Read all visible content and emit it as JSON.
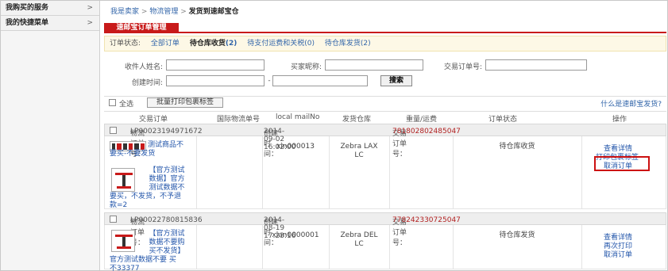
{
  "sidebar": {
    "items": [
      {
        "label": "我购买的服务",
        "arrow": ">"
      },
      {
        "label": "我的快捷菜单",
        "arrow": ">"
      }
    ]
  },
  "breadcrumb": {
    "items": [
      "我是卖家",
      "物流管理"
    ],
    "separator": ">",
    "current": "发货到速邮宝仓"
  },
  "tab": {
    "label": "速邮宝订单管理"
  },
  "status": {
    "label": "订单状态:",
    "filters": [
      {
        "label": "全部订单",
        "count": ""
      },
      {
        "label": "待仓库收货",
        "count": "(2)"
      },
      {
        "label": "待支付运费和关税",
        "count": "(0)"
      },
      {
        "label": "待仓库发货",
        "count": "(2)"
      }
    ]
  },
  "filter": {
    "recipient_label": "收件人姓名:",
    "buyer_label": "买家昵称:",
    "order_no_label": "交易订单号:",
    "created_label": "创建时间:",
    "range_sep": "-",
    "search_button": "搜索"
  },
  "selection": {
    "select_all": "全选",
    "batch_print": "批量打印包裹标签",
    "help": "什么是速邮宝发货?"
  },
  "columns": [
    "交易订单",
    "国际物流单号",
    "local mailNo",
    "发货仓库",
    "重量/运费",
    "订单状态",
    "操作"
  ],
  "orders": [
    {
      "logistics_label": "物流订单号：",
      "logistics_no": "LP00023194971672",
      "created_label": "创建时间：",
      "created": "2014-09-02 16:02:00",
      "trade_label": "交易订单号：",
      "trade_no": "781802802485047",
      "products": [
        {
          "line1": "测试商品不",
          "line2": "要买-不要发货"
        },
        {
          "line1": "【官方测试",
          "line2": "数据】官方",
          "line3": "测试数据不",
          "line4": "要买，不发货，不予退",
          "line5": "款=2"
        }
      ],
      "intl_no": "",
      "local_mail": "xin000013",
      "warehouse_line1": "Zebra LAX",
      "warehouse_line2": "LC",
      "status": "待仓库收货",
      "actions": [
        "查看详情",
        "打印包裹标签",
        "取消订单"
      ]
    },
    {
      "logistics_label": "物流订单号：",
      "logistics_no": "LP00022780815836",
      "created_label": "创建时间：",
      "created": "2014-08-19 17:23:16",
      "trade_label": "交易订单号：",
      "trade_no": "778242330725047",
      "products": [
        {
          "line1": "【官方测试",
          "line2": "数据不要购",
          "line3": "买不发货】",
          "line4": "官方测试数据不要 买",
          "line5": "不33377"
        }
      ],
      "intl_no": "",
      "local_mail": "xian0000001",
      "warehouse_line1": "Zebra DEL",
      "warehouse_line2": "LC",
      "status": "待仓库发货",
      "actions": [
        "查看详情",
        "再次打印",
        "取消订单"
      ]
    }
  ],
  "colors": {
    "accent": "#c81a1a",
    "link": "#2255aa",
    "trade_no": "#b22222",
    "status_bg": "#fdf8e6"
  }
}
